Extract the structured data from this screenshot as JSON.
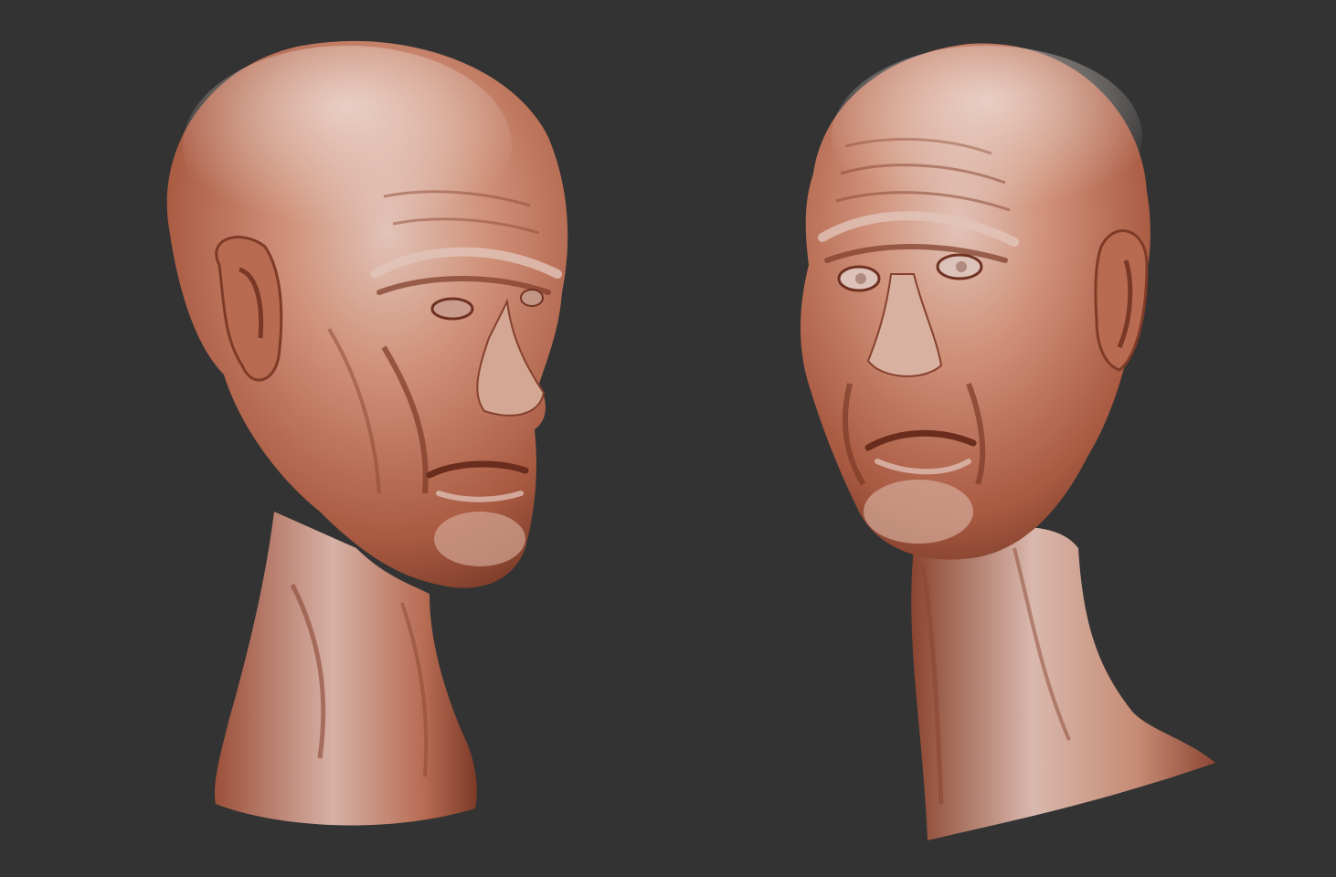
{
  "scene": {
    "background_color": "#333333",
    "clay_base_color": "#c9826a",
    "clay_highlight_color": "#eaddd9",
    "clay_shadow_color": "#7a3a28",
    "heads": [
      {
        "name": "left-bust",
        "view": "three-quarter",
        "facing": "right"
      },
      {
        "name": "right-bust",
        "view": "three-quarter",
        "facing": "left"
      }
    ]
  }
}
